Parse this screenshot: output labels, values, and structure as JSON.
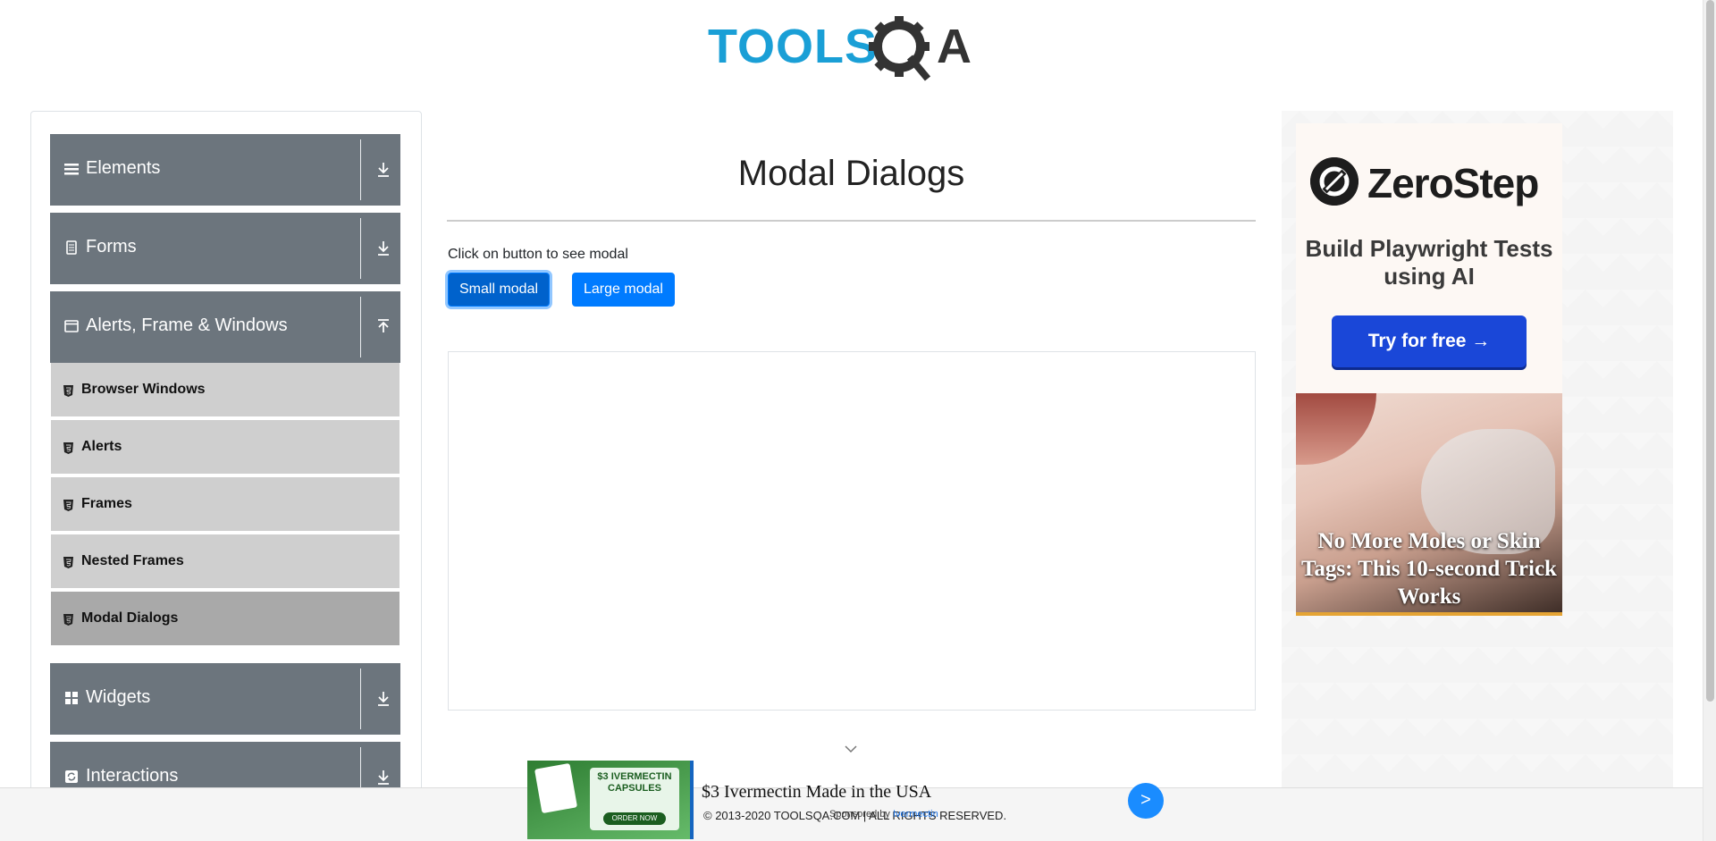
{
  "header": {
    "logo_text": "TOOLSQA"
  },
  "sidebar": {
    "groups": [
      {
        "label": "Elements",
        "icon": "list-icon",
        "expanded": false
      },
      {
        "label": "Forms",
        "icon": "document-icon",
        "expanded": false
      },
      {
        "label": "Alerts, Frame & Windows",
        "icon": "window-icon",
        "expanded": true
      },
      {
        "label": "Widgets",
        "icon": "grid-icon",
        "expanded": false
      },
      {
        "label": "Interactions",
        "icon": "refresh-icon",
        "expanded": false
      }
    ],
    "sub_items": [
      {
        "label": "Browser Windows",
        "active": false
      },
      {
        "label": "Alerts",
        "active": false
      },
      {
        "label": "Frames",
        "active": false
      },
      {
        "label": "Nested Frames",
        "active": false
      },
      {
        "label": "Modal Dialogs",
        "active": true
      }
    ]
  },
  "main": {
    "title": "Modal Dialogs",
    "hint": "Click on button to see modal",
    "small_modal_label": "Small modal",
    "large_modal_label": "Large modal"
  },
  "right_ad": {
    "brand": "ZeroStep",
    "tagline": "Build Playwright Tests using AI",
    "cta": "Try for free →",
    "mole_caption": "No More Moles or Skin Tags: This 10-second Trick Works"
  },
  "bottom_ad": {
    "product_text": "$3 IVERMECTIN CAPSULES",
    "order_label": "ORDER NOW",
    "headline": "$3 Ivermectin Made in the USA",
    "sponsor_prefix": "Sponsored by",
    "sponsor_name": "Ivermectin",
    "go_label": ">"
  },
  "footer": {
    "copyright": "© 2013-2020 TOOLSQA.COM | ALL RIGHTS RESERVED."
  },
  "colors": {
    "group_bg": "#6c757d",
    "sub_bg": "#cfcfcf",
    "sub_active_bg": "#a9a9a9",
    "button_primary": "#007bff",
    "logo_blue": "#1a9fd6",
    "logo_dark": "#333333"
  }
}
